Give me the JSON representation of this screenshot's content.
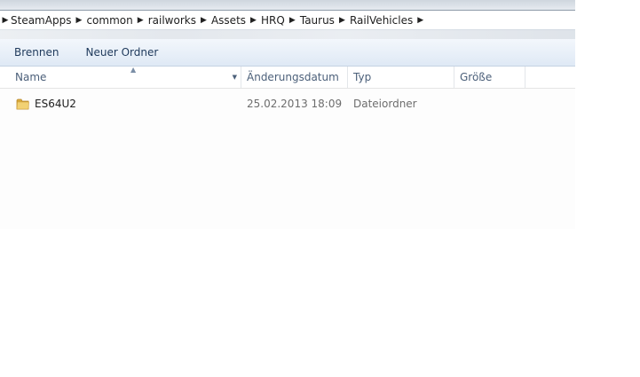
{
  "breadcrumb": [
    "SteamApps",
    "common",
    "railworks",
    "Assets",
    "HRQ",
    "Taurus",
    "RailVehicles"
  ],
  "toolbar": {
    "burn_label": "Brennen",
    "new_folder_label": "Neuer Ordner"
  },
  "columns": {
    "name": "Name",
    "date": "Änderungsdatum",
    "type": "Typ",
    "size": "Größe"
  },
  "rows": [
    {
      "name": "ES64U2",
      "date": "25.02.2013 18:09",
      "type": "Dateiordner",
      "icon": "folder-icon"
    }
  ],
  "colors": {
    "toolbar_text": "#1e395b",
    "header_text": "#4c607a",
    "folder": "#e8c25a"
  }
}
